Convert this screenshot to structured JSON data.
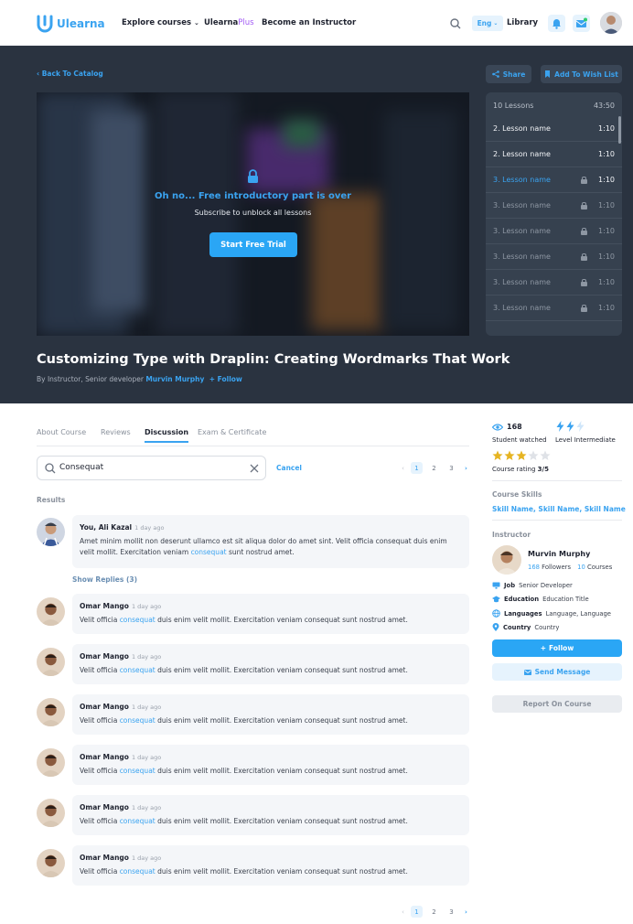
{
  "header": {
    "logo_text": "Ulearna",
    "nav": {
      "explore": "Explore courses",
      "plus_brand": "Ulearna",
      "plus_suffix": "Plus",
      "instructor": "Become an Instructor"
    },
    "lang": "Eng",
    "library": "Library"
  },
  "hero": {
    "back": "Back To Catalog",
    "share": "Share",
    "wishlist": "Add To Wish List",
    "video": {
      "headline": "Oh no... Free introductory part is over",
      "sub": "Subscribe to unblock all lessons",
      "cta": "Start Free Trial"
    },
    "lessons": {
      "count_label": "10 Lessons",
      "total_time": "43:50",
      "items": [
        {
          "name": "2. Lesson name",
          "time": "1:10",
          "state": "done"
        },
        {
          "name": "2. Lesson name",
          "time": "1:10",
          "state": "done"
        },
        {
          "name": "3. Lesson name",
          "time": "1:10",
          "state": "current"
        },
        {
          "name": "3. Lesson name",
          "time": "1:10",
          "state": "locked"
        },
        {
          "name": "3. Lesson name",
          "time": "1:10",
          "state": "locked"
        },
        {
          "name": "3. Lesson name",
          "time": "1:10",
          "state": "locked"
        },
        {
          "name": "3. Lesson name",
          "time": "1:10",
          "state": "locked"
        },
        {
          "name": "3. Lesson name",
          "time": "1:10",
          "state": "locked"
        }
      ]
    },
    "title": "Customizing Type with Draplin: Creating Wordmarks That Work",
    "byline": "By Instructor, Senior developer",
    "instructor_name": "Murvin Murphy",
    "follow": "Follow"
  },
  "tabs": [
    "About Course",
    "Reviews",
    "Discussion",
    "Exam & Certificate"
  ],
  "active_tab": "Discussion",
  "search": {
    "value": "Consequat",
    "cancel": "Cancel"
  },
  "pagination": {
    "pages": [
      "1",
      "2",
      "3"
    ],
    "current": "1"
  },
  "results_label": "Results",
  "comments": {
    "first": {
      "author": "You, Ali Kazal",
      "time": "1 day ago",
      "text_a": "Amet minim mollit non deserunt ullamco est sit aliqua dolor do amet sint. Velit officia consequat duis enim velit mollit. Exercitation veniam ",
      "highlight": "consequat",
      "text_b": " sunt nostrud amet."
    },
    "show_replies": "Show Replies (3)",
    "replies": [
      {
        "author": "Omar Mango",
        "time": "1 day ago",
        "text_a": "Velit officia ",
        "highlight": "consequat",
        "text_b": " duis enim velit mollit. Exercitation veniam consequat sunt nostrud amet."
      },
      {
        "author": "Omar Mango",
        "time": "1 day ago",
        "text_a": "Velit officia ",
        "highlight": "consequat",
        "text_b": " duis enim velit mollit. Exercitation veniam consequat sunt nostrud amet."
      },
      {
        "author": "Omar Mango",
        "time": "1 day ago",
        "text_a": "Velit officia ",
        "highlight": "consequat",
        "text_b": " duis enim velit mollit. Exercitation veniam consequat sunt nostrud amet."
      },
      {
        "author": "Omar Mango",
        "time": "1 day ago",
        "text_a": "Velit officia ",
        "highlight": "consequat",
        "text_b": " duis enim velit mollit. Exercitation veniam consequat sunt nostrud amet."
      },
      {
        "author": "Omar Mango",
        "time": "1 day ago",
        "text_a": "Velit officia ",
        "highlight": "consequat",
        "text_b": " duis enim velit mollit. Exercitation veniam consequat sunt nostrud amet."
      },
      {
        "author": "Omar Mango",
        "time": "1 day ago",
        "text_a": "Velit officia ",
        "highlight": "consequat",
        "text_b": " duis enim velit mollit. Exercitation veniam consequat sunt nostrud amet."
      }
    ]
  },
  "sidebar": {
    "watched_count": "168",
    "watched_label": "Student watched",
    "level_label": "Level Intermediate",
    "level_value": 2,
    "level_max": 3,
    "rating_label": "Course rating",
    "rating_value": "3/5",
    "rating_stars": 3,
    "skills_heading": "Course Skills",
    "skills": [
      "Skill Name",
      "Skill Name",
      "Skill Name"
    ],
    "instructor_heading": "Instructor",
    "instructor": {
      "name": "Murvin Murphy",
      "followers_count": "168",
      "followers_label": "Followers",
      "courses_count": "10",
      "courses_label": "Courses",
      "job_key": "Job",
      "job": "Senior Developer",
      "education_key": "Education",
      "education": "Education Title",
      "languages_key": "Languages",
      "languages": "Language, Language",
      "country_key": "Country",
      "country": "Country"
    },
    "follow": "Follow",
    "send_message": "Send Message",
    "report": "Report On Course"
  },
  "colors": {
    "accent": "#3aa3f0",
    "plus": "#a35cf5",
    "dark_bg": "#2a3340",
    "panel": "#36414f"
  }
}
